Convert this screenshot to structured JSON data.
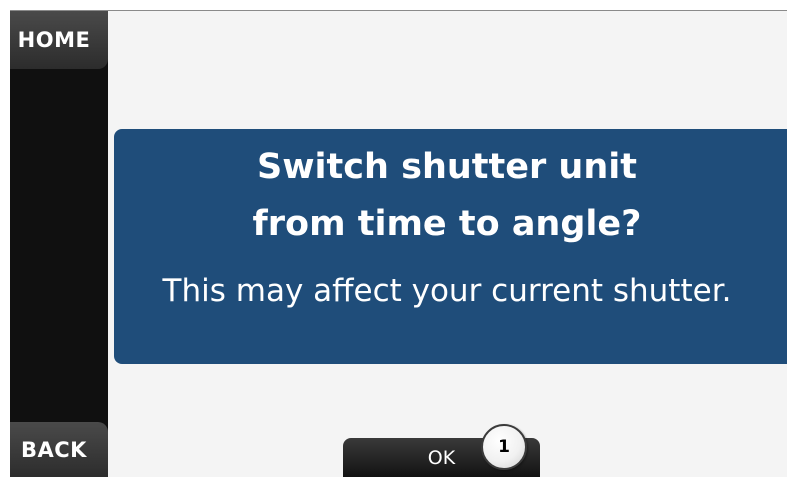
{
  "sidebar": {
    "home_label": "HOME",
    "back_label": "BACK"
  },
  "dialog": {
    "title": "Switch shutter unit\nfrom time to angle?",
    "message": "This may affect your current shutter."
  },
  "actions": {
    "ok_label": "OK"
  },
  "callout": {
    "number": "1"
  },
  "colors": {
    "dialog_background": "#1f4d7a",
    "sidebar_background": "#101010",
    "screen_background": "#f4f4f4",
    "button_background": "#111111"
  }
}
